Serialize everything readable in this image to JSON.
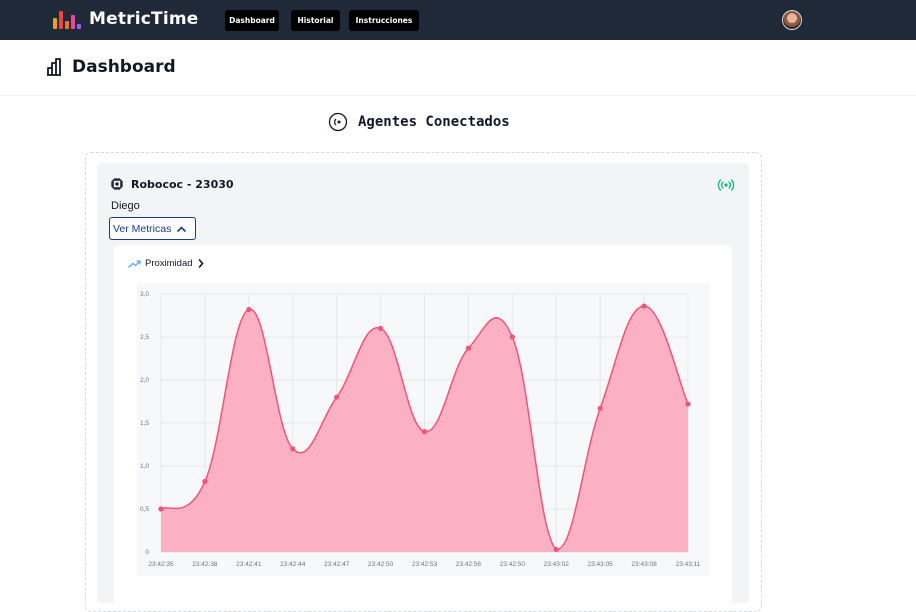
{
  "app": {
    "brand": "MetricTime",
    "logo_icon": "bar-chart-logo-icon",
    "logo_colors": [
      "#f59e0b",
      "#ef4444",
      "#f97316",
      "#ec4899",
      "#a855f7"
    ]
  },
  "nav": {
    "items": [
      {
        "label": "Dashboard"
      },
      {
        "label": "Historial"
      },
      {
        "label": "Instrucciones"
      }
    ],
    "avatar_icon": "user-avatar"
  },
  "page": {
    "title": "Dashboard",
    "title_icon": "bar-chart-outline-icon"
  },
  "section": {
    "title": "Agentes Conectados",
    "icon": "signal-circle-icon"
  },
  "agent": {
    "name": "Robococ - 23030",
    "chip_icon": "cpu-chip-icon",
    "user": "Diego",
    "status_icon": "broadcast-signal-icon",
    "status_color": "#10b981",
    "toggle_label": "Ver Metricas",
    "toggle_icon": "chevron-up-icon"
  },
  "metric": {
    "label": "Proximidad",
    "icon": "trending-up-icon",
    "chevron_icon": "chevron-right-icon"
  },
  "chart_data": {
    "type": "area",
    "x": [
      "23:42:35",
      "23:42:38",
      "23:42:41",
      "23:42:44",
      "23:42:47",
      "23:42:50",
      "23:42:53",
      "23:42:56",
      "23:42:50",
      "23:43:02",
      "23:43:05",
      "23:43:08",
      "23:43:11"
    ],
    "series": [
      {
        "values": [
          0.5,
          0.82,
          2.82,
          1.2,
          1.8,
          2.6,
          1.4,
          2.37,
          2.5,
          0.03,
          1.67,
          2.86,
          1.72
        ]
      }
    ],
    "ylim": [
      0,
      3.0
    ],
    "yticks": [
      "0",
      "0,5",
      "1,0",
      "1,5",
      "2,0",
      "2,5",
      "3,0"
    ],
    "grid": true,
    "line_color": "#f0547a",
    "fill_color": "#fbb1c3"
  }
}
